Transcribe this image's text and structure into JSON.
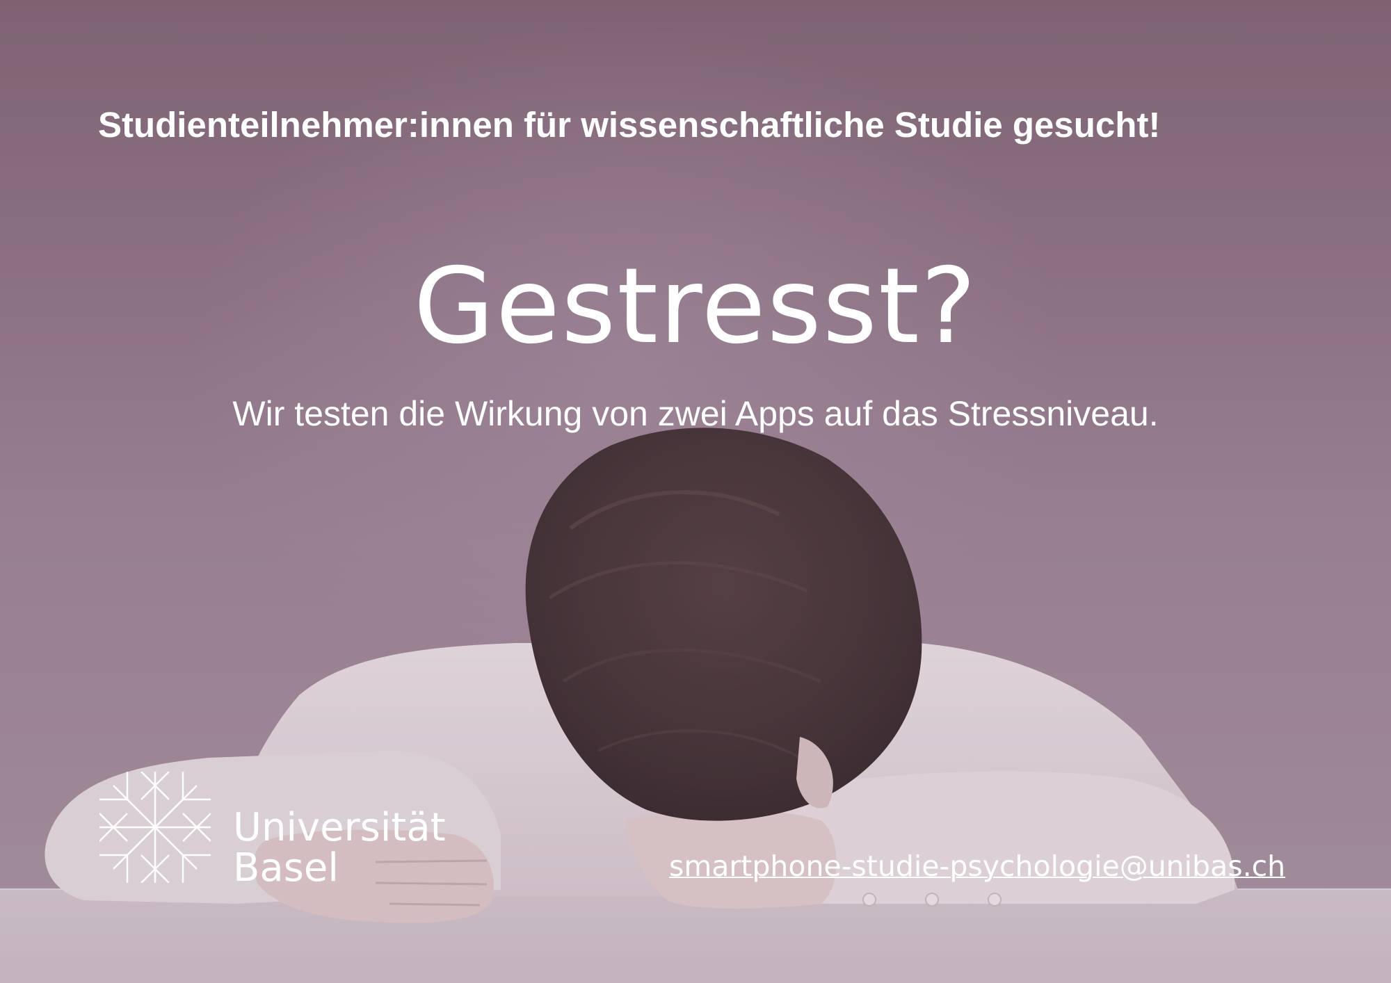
{
  "poster": {
    "headline_top": "Studienteilnehmer:innen für wissenschaftliche Studie gesucht!",
    "headline_main": "Gestresst?",
    "subline": "Wir testen die Wirkung von zwei Apps auf das Stressniveau.",
    "contact_email": "smartphone-studie-psychologie@unibas.ch"
  },
  "logo": {
    "line1": "Universität",
    "line2": "Basel",
    "icon": "university-basel-star-icon"
  },
  "photo": {
    "subject": "person-head-on-desk-image"
  },
  "colors": {
    "background_top": "#7b6170",
    "background_mid": "#9c8497",
    "text": "#ffffff",
    "shirt": "#efe6ea",
    "hair": "#3a2a2c",
    "desk": "#d7cbd3"
  }
}
